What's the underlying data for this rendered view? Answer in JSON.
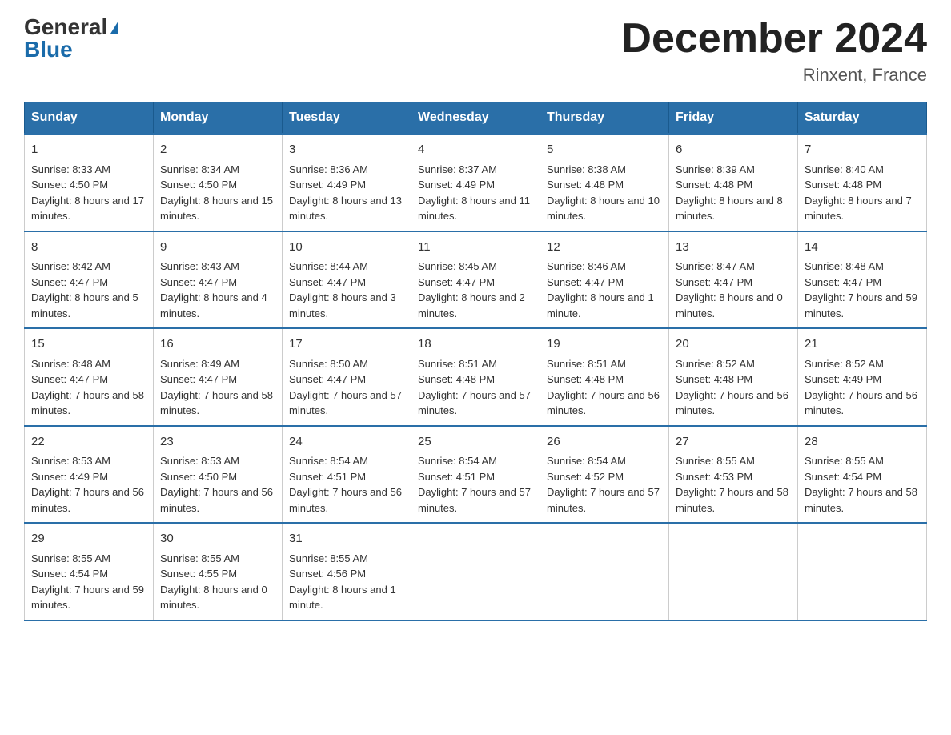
{
  "header": {
    "logo_general": "General",
    "logo_blue": "Blue",
    "main_title": "December 2024",
    "subtitle": "Rinxent, France"
  },
  "columns": [
    "Sunday",
    "Monday",
    "Tuesday",
    "Wednesday",
    "Thursday",
    "Friday",
    "Saturday"
  ],
  "weeks": [
    [
      {
        "day": "1",
        "sunrise": "Sunrise: 8:33 AM",
        "sunset": "Sunset: 4:50 PM",
        "daylight": "Daylight: 8 hours and 17 minutes."
      },
      {
        "day": "2",
        "sunrise": "Sunrise: 8:34 AM",
        "sunset": "Sunset: 4:50 PM",
        "daylight": "Daylight: 8 hours and 15 minutes."
      },
      {
        "day": "3",
        "sunrise": "Sunrise: 8:36 AM",
        "sunset": "Sunset: 4:49 PM",
        "daylight": "Daylight: 8 hours and 13 minutes."
      },
      {
        "day": "4",
        "sunrise": "Sunrise: 8:37 AM",
        "sunset": "Sunset: 4:49 PM",
        "daylight": "Daylight: 8 hours and 11 minutes."
      },
      {
        "day": "5",
        "sunrise": "Sunrise: 8:38 AM",
        "sunset": "Sunset: 4:48 PM",
        "daylight": "Daylight: 8 hours and 10 minutes."
      },
      {
        "day": "6",
        "sunrise": "Sunrise: 8:39 AM",
        "sunset": "Sunset: 4:48 PM",
        "daylight": "Daylight: 8 hours and 8 minutes."
      },
      {
        "day": "7",
        "sunrise": "Sunrise: 8:40 AM",
        "sunset": "Sunset: 4:48 PM",
        "daylight": "Daylight: 8 hours and 7 minutes."
      }
    ],
    [
      {
        "day": "8",
        "sunrise": "Sunrise: 8:42 AM",
        "sunset": "Sunset: 4:47 PM",
        "daylight": "Daylight: 8 hours and 5 minutes."
      },
      {
        "day": "9",
        "sunrise": "Sunrise: 8:43 AM",
        "sunset": "Sunset: 4:47 PM",
        "daylight": "Daylight: 8 hours and 4 minutes."
      },
      {
        "day": "10",
        "sunrise": "Sunrise: 8:44 AM",
        "sunset": "Sunset: 4:47 PM",
        "daylight": "Daylight: 8 hours and 3 minutes."
      },
      {
        "day": "11",
        "sunrise": "Sunrise: 8:45 AM",
        "sunset": "Sunset: 4:47 PM",
        "daylight": "Daylight: 8 hours and 2 minutes."
      },
      {
        "day": "12",
        "sunrise": "Sunrise: 8:46 AM",
        "sunset": "Sunset: 4:47 PM",
        "daylight": "Daylight: 8 hours and 1 minute."
      },
      {
        "day": "13",
        "sunrise": "Sunrise: 8:47 AM",
        "sunset": "Sunset: 4:47 PM",
        "daylight": "Daylight: 8 hours and 0 minutes."
      },
      {
        "day": "14",
        "sunrise": "Sunrise: 8:48 AM",
        "sunset": "Sunset: 4:47 PM",
        "daylight": "Daylight: 7 hours and 59 minutes."
      }
    ],
    [
      {
        "day": "15",
        "sunrise": "Sunrise: 8:48 AM",
        "sunset": "Sunset: 4:47 PM",
        "daylight": "Daylight: 7 hours and 58 minutes."
      },
      {
        "day": "16",
        "sunrise": "Sunrise: 8:49 AM",
        "sunset": "Sunset: 4:47 PM",
        "daylight": "Daylight: 7 hours and 58 minutes."
      },
      {
        "day": "17",
        "sunrise": "Sunrise: 8:50 AM",
        "sunset": "Sunset: 4:47 PM",
        "daylight": "Daylight: 7 hours and 57 minutes."
      },
      {
        "day": "18",
        "sunrise": "Sunrise: 8:51 AM",
        "sunset": "Sunset: 4:48 PM",
        "daylight": "Daylight: 7 hours and 57 minutes."
      },
      {
        "day": "19",
        "sunrise": "Sunrise: 8:51 AM",
        "sunset": "Sunset: 4:48 PM",
        "daylight": "Daylight: 7 hours and 56 minutes."
      },
      {
        "day": "20",
        "sunrise": "Sunrise: 8:52 AM",
        "sunset": "Sunset: 4:48 PM",
        "daylight": "Daylight: 7 hours and 56 minutes."
      },
      {
        "day": "21",
        "sunrise": "Sunrise: 8:52 AM",
        "sunset": "Sunset: 4:49 PM",
        "daylight": "Daylight: 7 hours and 56 minutes."
      }
    ],
    [
      {
        "day": "22",
        "sunrise": "Sunrise: 8:53 AM",
        "sunset": "Sunset: 4:49 PM",
        "daylight": "Daylight: 7 hours and 56 minutes."
      },
      {
        "day": "23",
        "sunrise": "Sunrise: 8:53 AM",
        "sunset": "Sunset: 4:50 PM",
        "daylight": "Daylight: 7 hours and 56 minutes."
      },
      {
        "day": "24",
        "sunrise": "Sunrise: 8:54 AM",
        "sunset": "Sunset: 4:51 PM",
        "daylight": "Daylight: 7 hours and 56 minutes."
      },
      {
        "day": "25",
        "sunrise": "Sunrise: 8:54 AM",
        "sunset": "Sunset: 4:51 PM",
        "daylight": "Daylight: 7 hours and 57 minutes."
      },
      {
        "day": "26",
        "sunrise": "Sunrise: 8:54 AM",
        "sunset": "Sunset: 4:52 PM",
        "daylight": "Daylight: 7 hours and 57 minutes."
      },
      {
        "day": "27",
        "sunrise": "Sunrise: 8:55 AM",
        "sunset": "Sunset: 4:53 PM",
        "daylight": "Daylight: 7 hours and 58 minutes."
      },
      {
        "day": "28",
        "sunrise": "Sunrise: 8:55 AM",
        "sunset": "Sunset: 4:54 PM",
        "daylight": "Daylight: 7 hours and 58 minutes."
      }
    ],
    [
      {
        "day": "29",
        "sunrise": "Sunrise: 8:55 AM",
        "sunset": "Sunset: 4:54 PM",
        "daylight": "Daylight: 7 hours and 59 minutes."
      },
      {
        "day": "30",
        "sunrise": "Sunrise: 8:55 AM",
        "sunset": "Sunset: 4:55 PM",
        "daylight": "Daylight: 8 hours and 0 minutes."
      },
      {
        "day": "31",
        "sunrise": "Sunrise: 8:55 AM",
        "sunset": "Sunset: 4:56 PM",
        "daylight": "Daylight: 8 hours and 1 minute."
      },
      {
        "day": "",
        "sunrise": "",
        "sunset": "",
        "daylight": ""
      },
      {
        "day": "",
        "sunrise": "",
        "sunset": "",
        "daylight": ""
      },
      {
        "day": "",
        "sunrise": "",
        "sunset": "",
        "daylight": ""
      },
      {
        "day": "",
        "sunrise": "",
        "sunset": "",
        "daylight": ""
      }
    ]
  ]
}
